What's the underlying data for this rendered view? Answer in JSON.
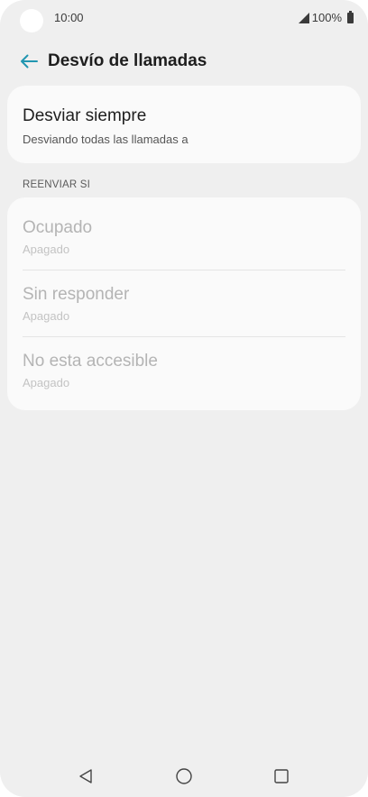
{
  "status_bar": {
    "time": "10:00",
    "battery_text": "100%",
    "icons": [
      "signal-icon",
      "battery-icon"
    ]
  },
  "header": {
    "title": "Desvío de llamadas",
    "back_icon": "arrow-left-icon"
  },
  "always_forward": {
    "title": "Desviar siempre",
    "subtitle": "Desviando todas las llamadas a"
  },
  "section": {
    "label": "REENVIAR SI"
  },
  "conditional": [
    {
      "title": "Ocupado",
      "subtitle": "Apagado"
    },
    {
      "title": "Sin responder",
      "subtitle": "Apagado"
    },
    {
      "title": "No esta accesible",
      "subtitle": "Apagado"
    }
  ],
  "nav": {
    "icons": [
      "triangle-back-icon",
      "circle-home-icon",
      "square-recent-icon"
    ]
  },
  "colors": {
    "accent": "#2196b0",
    "background": "#efefef",
    "card": "#fafafa",
    "disabled_text": "#b4b4b4"
  }
}
